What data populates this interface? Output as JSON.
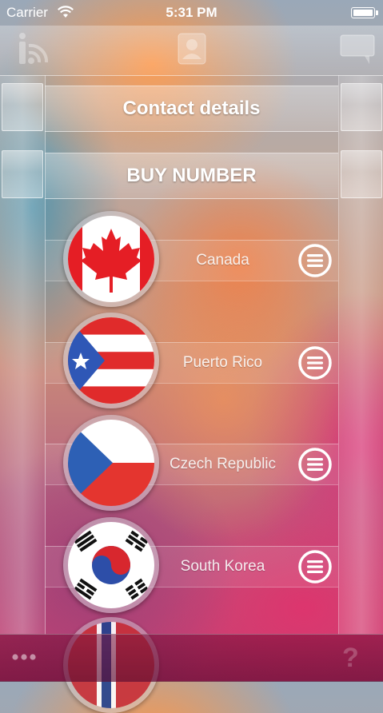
{
  "status_bar": {
    "carrier": "Carrier",
    "time": "5:31 PM"
  },
  "top_bar": {
    "icons": [
      "info-wifi-icon",
      "contacts-icon",
      "chat-bubble-icon"
    ]
  },
  "headers": {
    "contact_details": "Contact details",
    "buy_number": "BUY NUMBER"
  },
  "countries": [
    {
      "name": "Canada",
      "flag": "canada-flag-icon"
    },
    {
      "name": "Puerto Rico",
      "flag": "puerto-rico-flag-icon"
    },
    {
      "name": "Czech Republic",
      "flag": "czech-flag-icon"
    },
    {
      "name": "South Korea",
      "flag": "south-korea-flag-icon"
    }
  ],
  "bottom_bar": {
    "left_icon": "more-dots-icon",
    "help": "?"
  },
  "colors": {
    "canada_red": "#e51e25",
    "puerto_rico_red": "#e02b2b",
    "puerto_rico_blue": "#2f57b6",
    "czech_blue": "#2d60b5",
    "czech_red": "#e4352f"
  }
}
